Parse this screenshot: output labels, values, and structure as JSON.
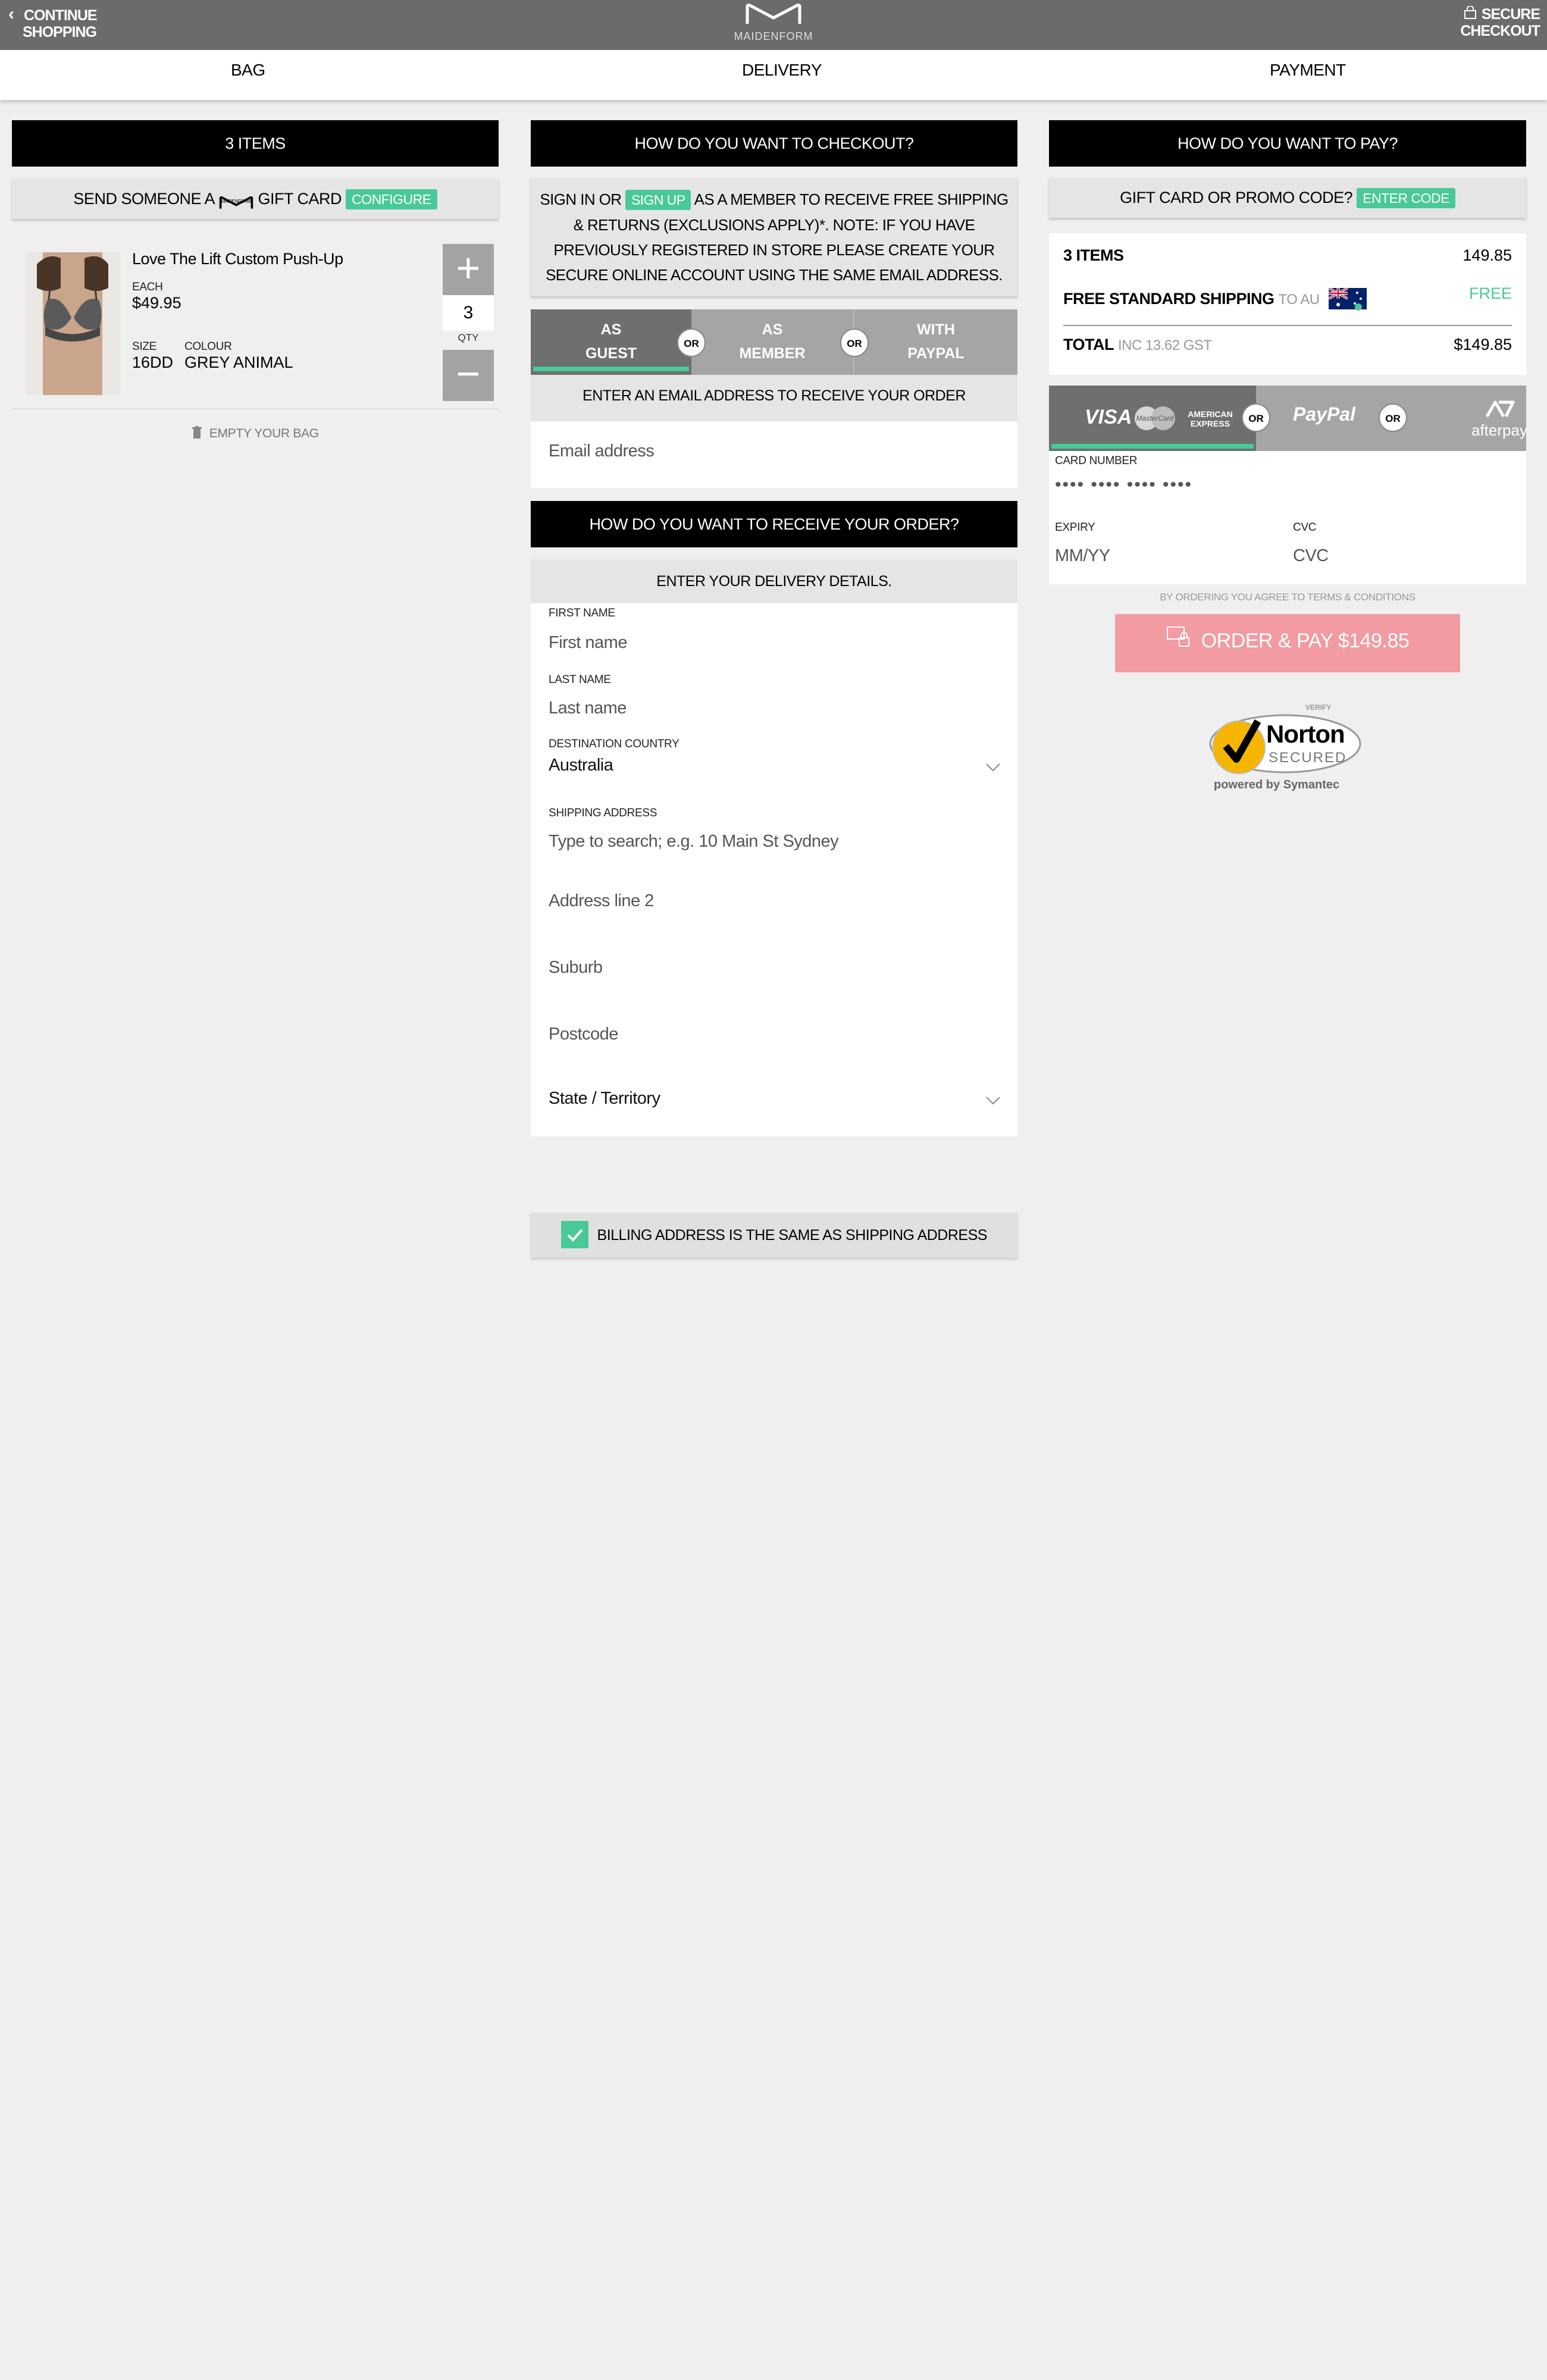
{
  "header": {
    "continue_line1": "CONTINUE",
    "continue_line2": "SHOPPING",
    "logo_word": "MAIDENFORM",
    "secure_line1": "SECURE",
    "secure_line2": "CHECKOUT"
  },
  "steps": [
    "BAG",
    "DELIVERY",
    "PAYMENT"
  ],
  "bag": {
    "heading": "3 ITEMS",
    "gift_prefix": "SEND SOMEONE A",
    "gift_logo_word": "MAIDENFORM",
    "gift_suffix": "GIFT CARD",
    "gift_button": "CONFIGURE",
    "product": {
      "title": "Love The Lift Custom Push-Up",
      "each_label": "EACH",
      "price": "$49.95",
      "size_label": "SIZE",
      "size": "16DD",
      "colour_label": "COLOUR",
      "colour": "GREY ANIMAL",
      "qty": "3",
      "qty_label": "QTY",
      "plus": "+",
      "minus": "−"
    },
    "empty": "EMPTY YOUR BAG"
  },
  "delivery": {
    "heading": "HOW DO YOU WANT TO CHECKOUT?",
    "signin_pre": "SIGN IN OR",
    "signup_button": "SIGN UP",
    "signin_post": "AS A MEMBER TO RECEIVE FREE SHIPPING & RETURNS (EXCLUSIONS APPLY)*. NOTE: IF YOU HAVE PREVIOUSLY REGISTERED IN STORE PLEASE CREATE YOUR SECURE ONLINE ACCOUNT USING THE SAME EMAIL ADDRESS.",
    "tabs": [
      {
        "line1": "AS",
        "line2": "GUEST"
      },
      {
        "line1": "AS",
        "line2": "MEMBER"
      },
      {
        "line1": "WITH",
        "line2": "PAYPAL"
      }
    ],
    "or": "OR",
    "email_note": "ENTER AN EMAIL ADDRESS TO RECEIVE YOUR ORDER CONFIRMATION.",
    "email_placeholder": "Email address",
    "receive_heading": "HOW DO YOU WANT TO RECEIVE YOUR ORDER?",
    "details_note": "ENTER YOUR DELIVERY DETAILS.",
    "first_name_label": "FIRST NAME",
    "first_name_placeholder": "First name",
    "last_name_label": "LAST NAME",
    "last_name_placeholder": "Last name",
    "country_label": "DESTINATION COUNTRY",
    "country_value": "Australia",
    "shipping_label": "SHIPPING ADDRESS",
    "shipping_placeholder": "Type to search; e.g. 10 Main St Sydney",
    "address2_placeholder": "Address line 2",
    "suburb_placeholder": "Suburb",
    "postcode_placeholder": "Postcode",
    "state_placeholder": "State / Territory",
    "billing_same": "BILLING ADDRESS IS THE SAME AS SHIPPING ADDRESS"
  },
  "payment": {
    "heading": "HOW DO YOU WANT TO PAY?",
    "promo_text": "GIFT CARD OR PROMO CODE?",
    "promo_button": "ENTER CODE",
    "summary": {
      "items_label": "3 ITEMS",
      "items_value": "149.85",
      "shipping_label": "FREE STANDARD SHIPPING",
      "shipping_to": "TO AU",
      "shipping_value": "FREE",
      "total_label": "TOTAL",
      "total_tax": "INC 13.62 GST",
      "total_value": "$149.85"
    },
    "method_visa": "VISA",
    "method_mastercard": "MasterCard",
    "method_amex_1": "AMERICAN",
    "method_amex_2": "EXPRESS",
    "method_paypal": "PayPal",
    "method_afterpay": "afterpay",
    "or": "OR",
    "card_number_label": "CARD NUMBER",
    "card_number_placeholder": "•••• •••• •••• ••••",
    "expiry_label": "EXPIRY",
    "expiry_placeholder": "MM/YY",
    "cvc_label": "CVC",
    "cvc_placeholder": "CVC",
    "terms": "BY ORDERING YOU AGREE TO TERMS & CONDITIONS",
    "pay_button": "ORDER & PAY  $149.85",
    "norton_verify": "VERIFY",
    "norton_name": "Norton",
    "norton_secured": "SECURED",
    "norton_powered": "powered by Symantec"
  },
  "colors": {
    "header": "#6b6b6b",
    "accent": "#49c997",
    "pay_button": "#f29ba2",
    "heading_bar": "#000000"
  }
}
